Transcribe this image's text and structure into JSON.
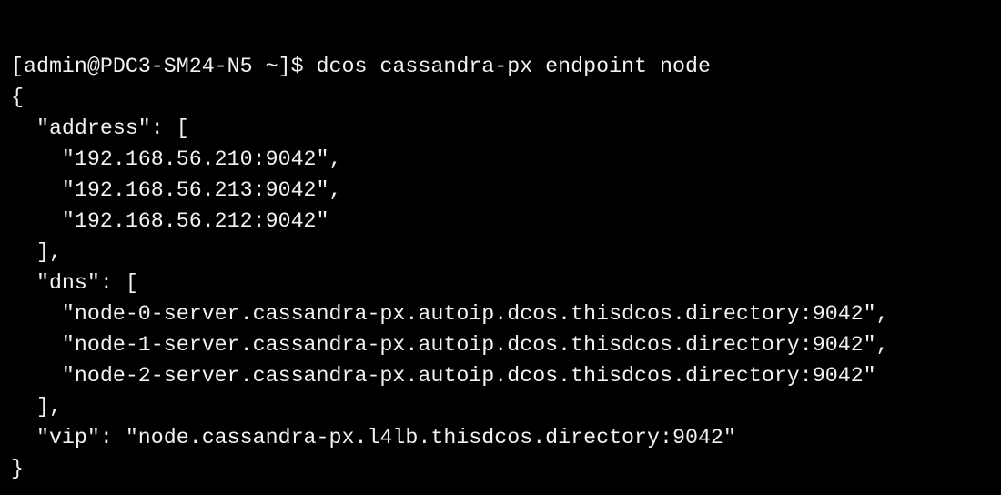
{
  "terminal": {
    "background": "#000000",
    "foreground": "#f2f2f2",
    "lines": [
      "[admin@PDC3-SM24-N5 ~]$ dcos cassandra-px endpoint node",
      "{",
      "  \"address\": [",
      "    \"192.168.56.210:9042\",",
      "    \"192.168.56.213:9042\",",
      "    \"192.168.56.212:9042\"",
      "  ],",
      "  \"dns\": [",
      "    \"node-0-server.cassandra-px.autoip.dcos.thisdcos.directory:9042\",",
      "    \"node-1-server.cassandra-px.autoip.dcos.thisdcos.directory:9042\",",
      "    \"node-2-server.cassandra-px.autoip.dcos.thisdcos.directory:9042\"",
      "  ],",
      "  \"vip\": \"node.cassandra-px.l4lb.thisdcos.directory:9042\"",
      "}"
    ]
  }
}
